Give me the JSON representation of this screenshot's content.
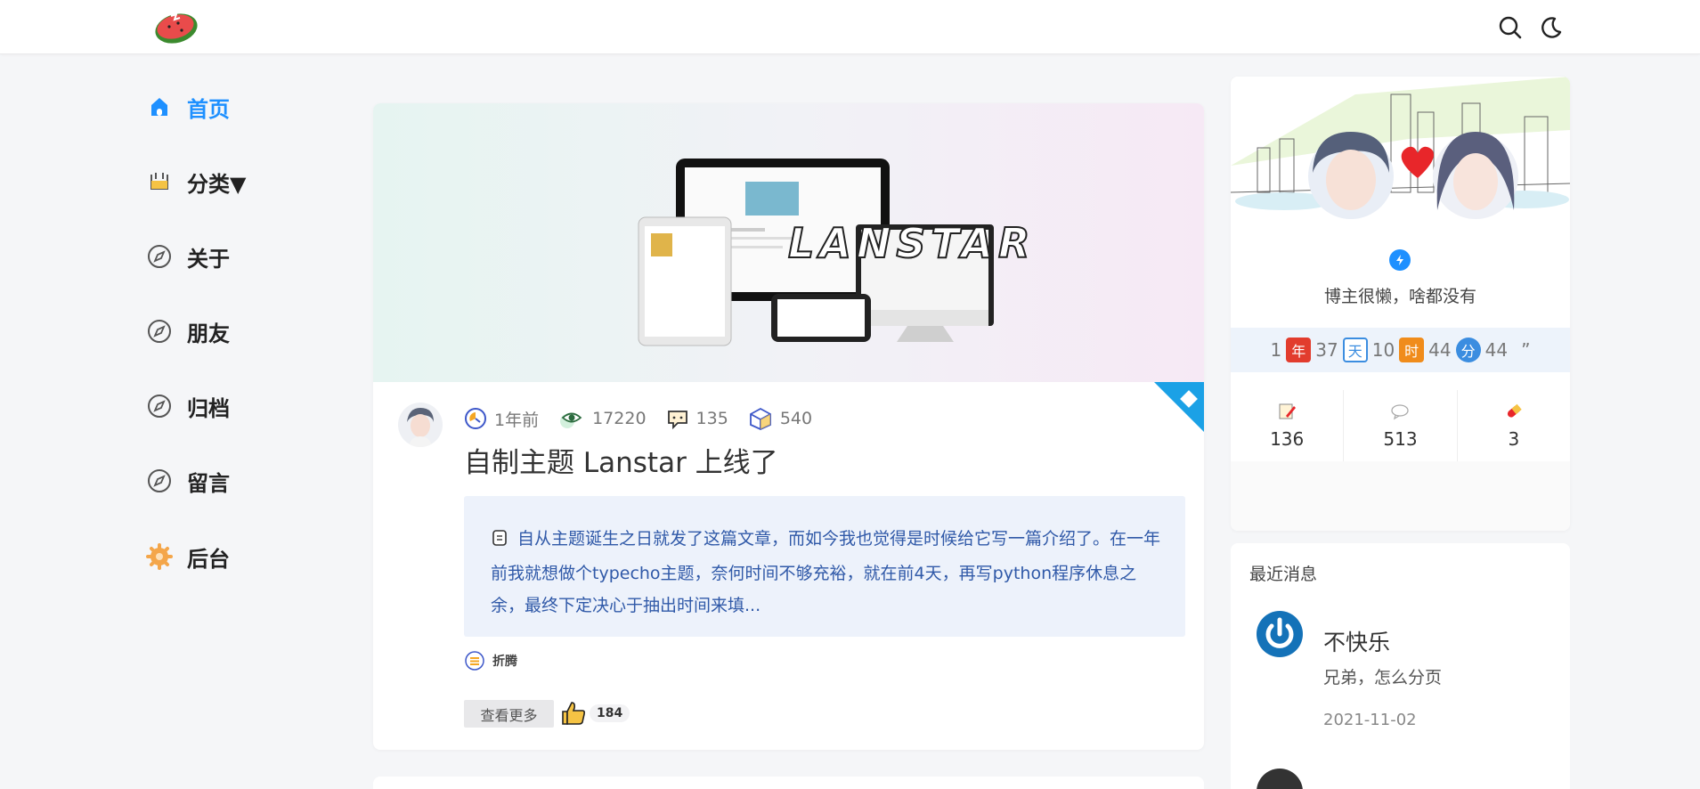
{
  "nav": {
    "items": [
      {
        "label": "首页",
        "icon": "home-icon",
        "active": true
      },
      {
        "label": "分类▼",
        "icon": "basket-icon"
      },
      {
        "label": "关于",
        "icon": "compass-icon"
      },
      {
        "label": "朋友",
        "icon": "compass-icon"
      },
      {
        "label": "归档",
        "icon": "compass-icon"
      },
      {
        "label": "留言",
        "icon": "compass-icon"
      },
      {
        "label": "后台",
        "icon": "gear-icon"
      }
    ]
  },
  "header": {
    "search_icon": "search-icon",
    "theme_icon": "moon-icon"
  },
  "post": {
    "banner_text": "LANSTAR",
    "time_ago": "1年前",
    "views": "17220",
    "comments": "135",
    "words": "540",
    "title": "自制主题 Lanstar 上线了",
    "excerpt": "自从主题诞生之日就发了这篇文章，而如今我也觉得是时候给它写一篇介绍了。在一年前我就想做个typecho主题，奈何时间不够充裕，就在前4天，再写python程序休息之余，最终下定决心于抽出时间来填...",
    "tag": "折腾",
    "more_label": "查看更多",
    "likes": "184"
  },
  "profile": {
    "motto": "博主很懒，啥都没有",
    "timer": {
      "years": "1",
      "year_badge": "年",
      "days": "37",
      "day_badge": "天",
      "hours": "10",
      "hour_badge": "时",
      "minutes": "44",
      "minute_badge": "分",
      "seconds": "44",
      "tail": "”"
    },
    "stats": {
      "posts": "136",
      "comments": "513",
      "tags": "3"
    }
  },
  "recent": {
    "heading": "最近消息",
    "items": [
      {
        "name": "不快乐",
        "text": "兄弟，怎么分页",
        "date": "2021-11-02"
      }
    ]
  },
  "colors": {
    "accent": "#1e90ff",
    "excerpt_bg": "#edf2fb",
    "excerpt_text": "#3059a8"
  }
}
